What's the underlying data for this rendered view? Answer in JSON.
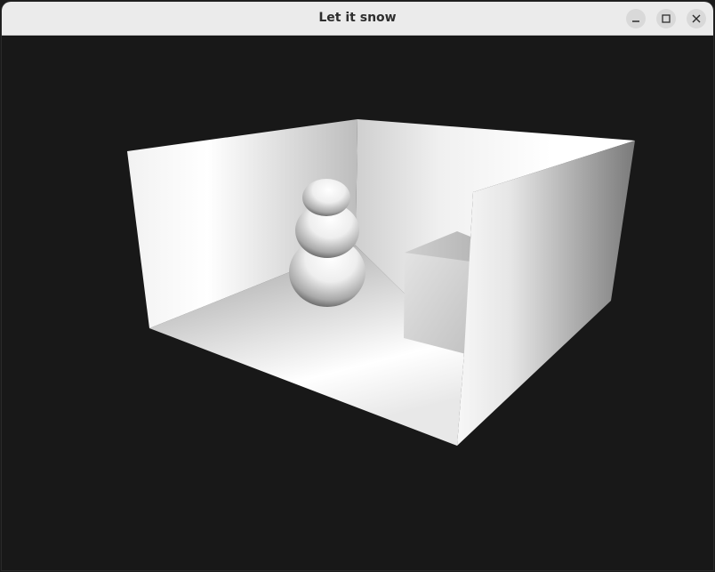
{
  "window": {
    "title": "Let it snow"
  },
  "controls": {
    "minimize_icon": "minimize-icon",
    "maximize_icon": "maximize-icon",
    "close_icon": "close-icon"
  },
  "scene": {
    "background_color": "#181818",
    "objects": [
      "room-box",
      "snowman",
      "cube"
    ]
  }
}
